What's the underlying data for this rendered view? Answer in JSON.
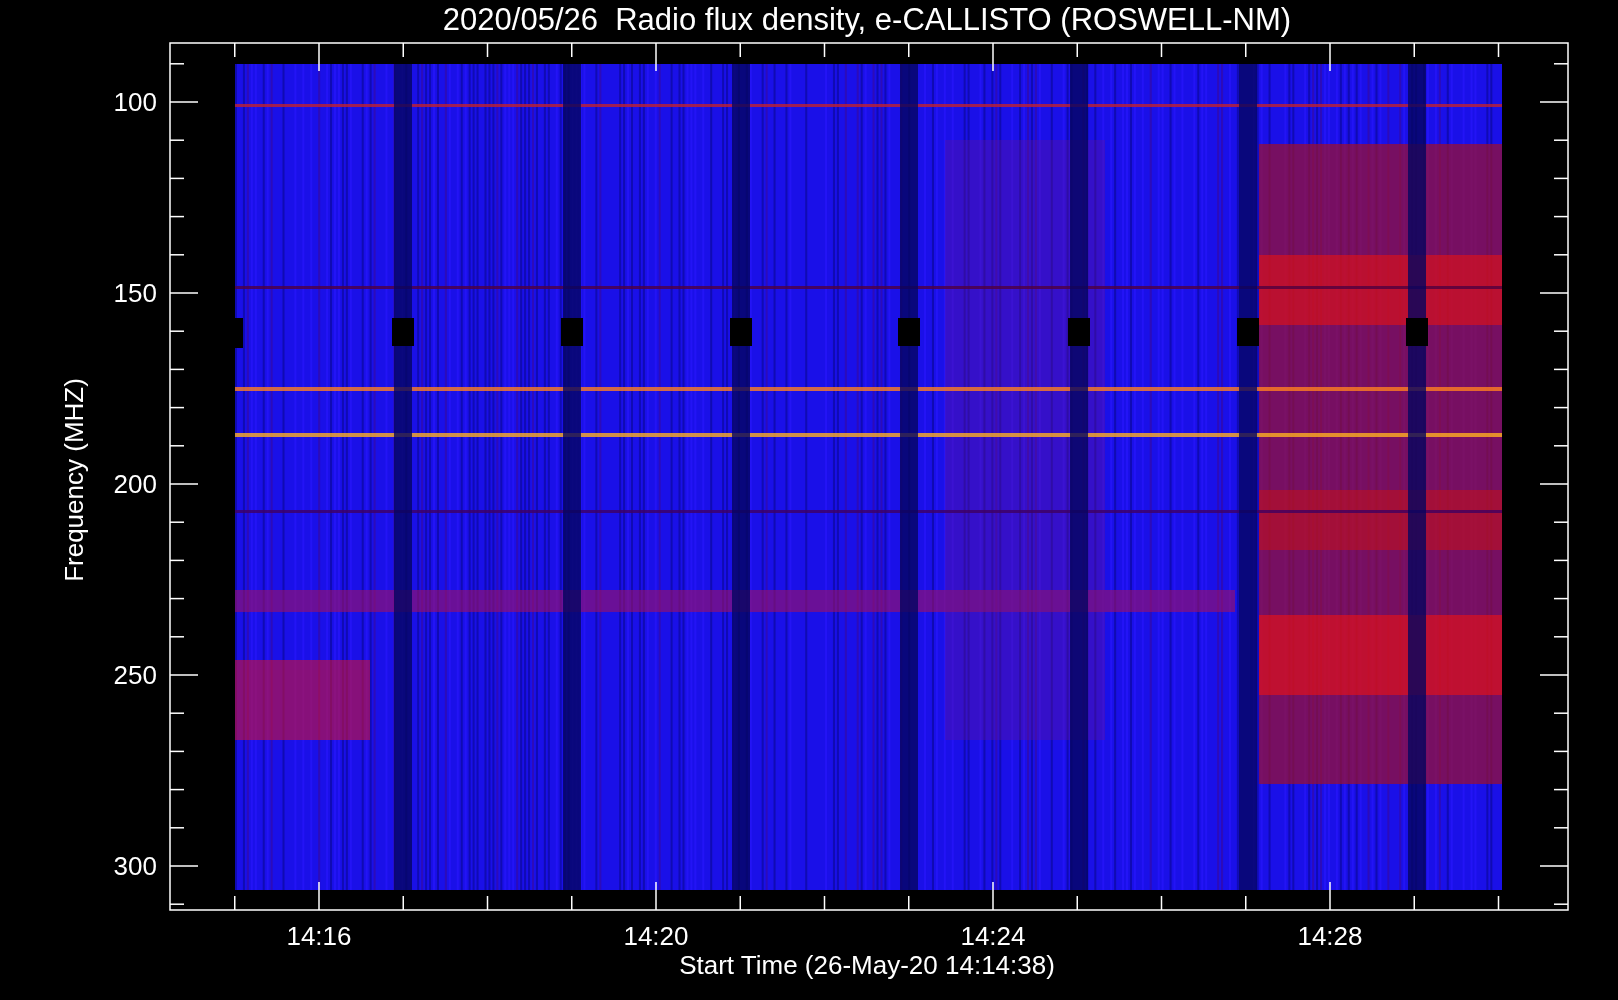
{
  "title": "2020/05/26  Radio flux density, e-CALLISTO (ROSWELL-NM)",
  "xlabel": "Start Time (26-May-20 14:14:38)",
  "ylabel": "Frequency (MHZ)",
  "yticks": [
    "100",
    "150",
    "200",
    "250",
    "300"
  ],
  "xticks": [
    "14:16",
    "14:20",
    "14:24",
    "14:28"
  ]
}
